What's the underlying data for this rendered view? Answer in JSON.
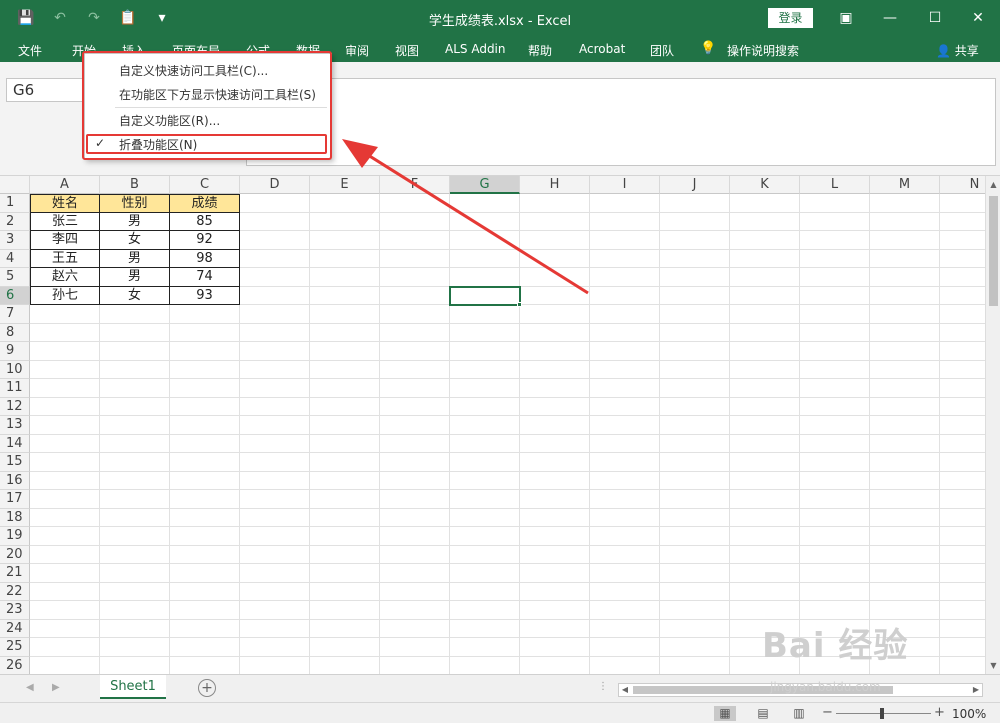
{
  "window": {
    "title": "学生成绩表.xlsx  -  Excel",
    "login_label": "登录"
  },
  "ribbon_tabs": [
    "文件",
    "开始",
    "插入",
    "页面布局",
    "公式",
    "数据",
    "审阅",
    "视图",
    "ALS Addin",
    "帮助",
    "Acrobat",
    "团队"
  ],
  "tell_me": "操作说明搜索",
  "share": "共享",
  "name_box": "G6",
  "context_menu": {
    "items": [
      {
        "label": "自定义快速访问工具栏(C)...",
        "checked": false
      },
      {
        "label": "在功能区下方显示快速访问工具栏(S)",
        "checked": false
      },
      {
        "label": "自定义功能区(R)...",
        "checked": false
      },
      {
        "label": "折叠功能区(N)",
        "checked": true
      }
    ],
    "check_mark": "✓"
  },
  "columns": [
    "A",
    "B",
    "C",
    "D",
    "E",
    "F",
    "G",
    "H",
    "I",
    "J",
    "K",
    "L",
    "M",
    "N"
  ],
  "selected_column": "G",
  "selected_row": 6,
  "row_numbers": [
    "1",
    "2",
    "3",
    "4",
    "5",
    "6",
    "7",
    "8",
    "9",
    "10",
    "11",
    "12",
    "13",
    "14",
    "15",
    "16",
    "17",
    "18",
    "19",
    "20",
    "21",
    "22",
    "23",
    "24",
    "25",
    "26"
  ],
  "table": {
    "header": [
      "姓名",
      "性别",
      "成绩"
    ],
    "rows": [
      [
        "张三",
        "男",
        "85"
      ],
      [
        "李四",
        "女",
        "92"
      ],
      [
        "王五",
        "男",
        "98"
      ],
      [
        "赵六",
        "男",
        "74"
      ],
      [
        "孙七",
        "女",
        "93"
      ]
    ]
  },
  "sheet_tab": "Sheet1",
  "zoom": "100%",
  "watermark": {
    "text": "Bai 经验",
    "sub": "jingyan.baidu.com"
  },
  "colors": {
    "excel_green": "#217346",
    "header_fill": "#ffe699",
    "annotation_red": "#e53935"
  }
}
